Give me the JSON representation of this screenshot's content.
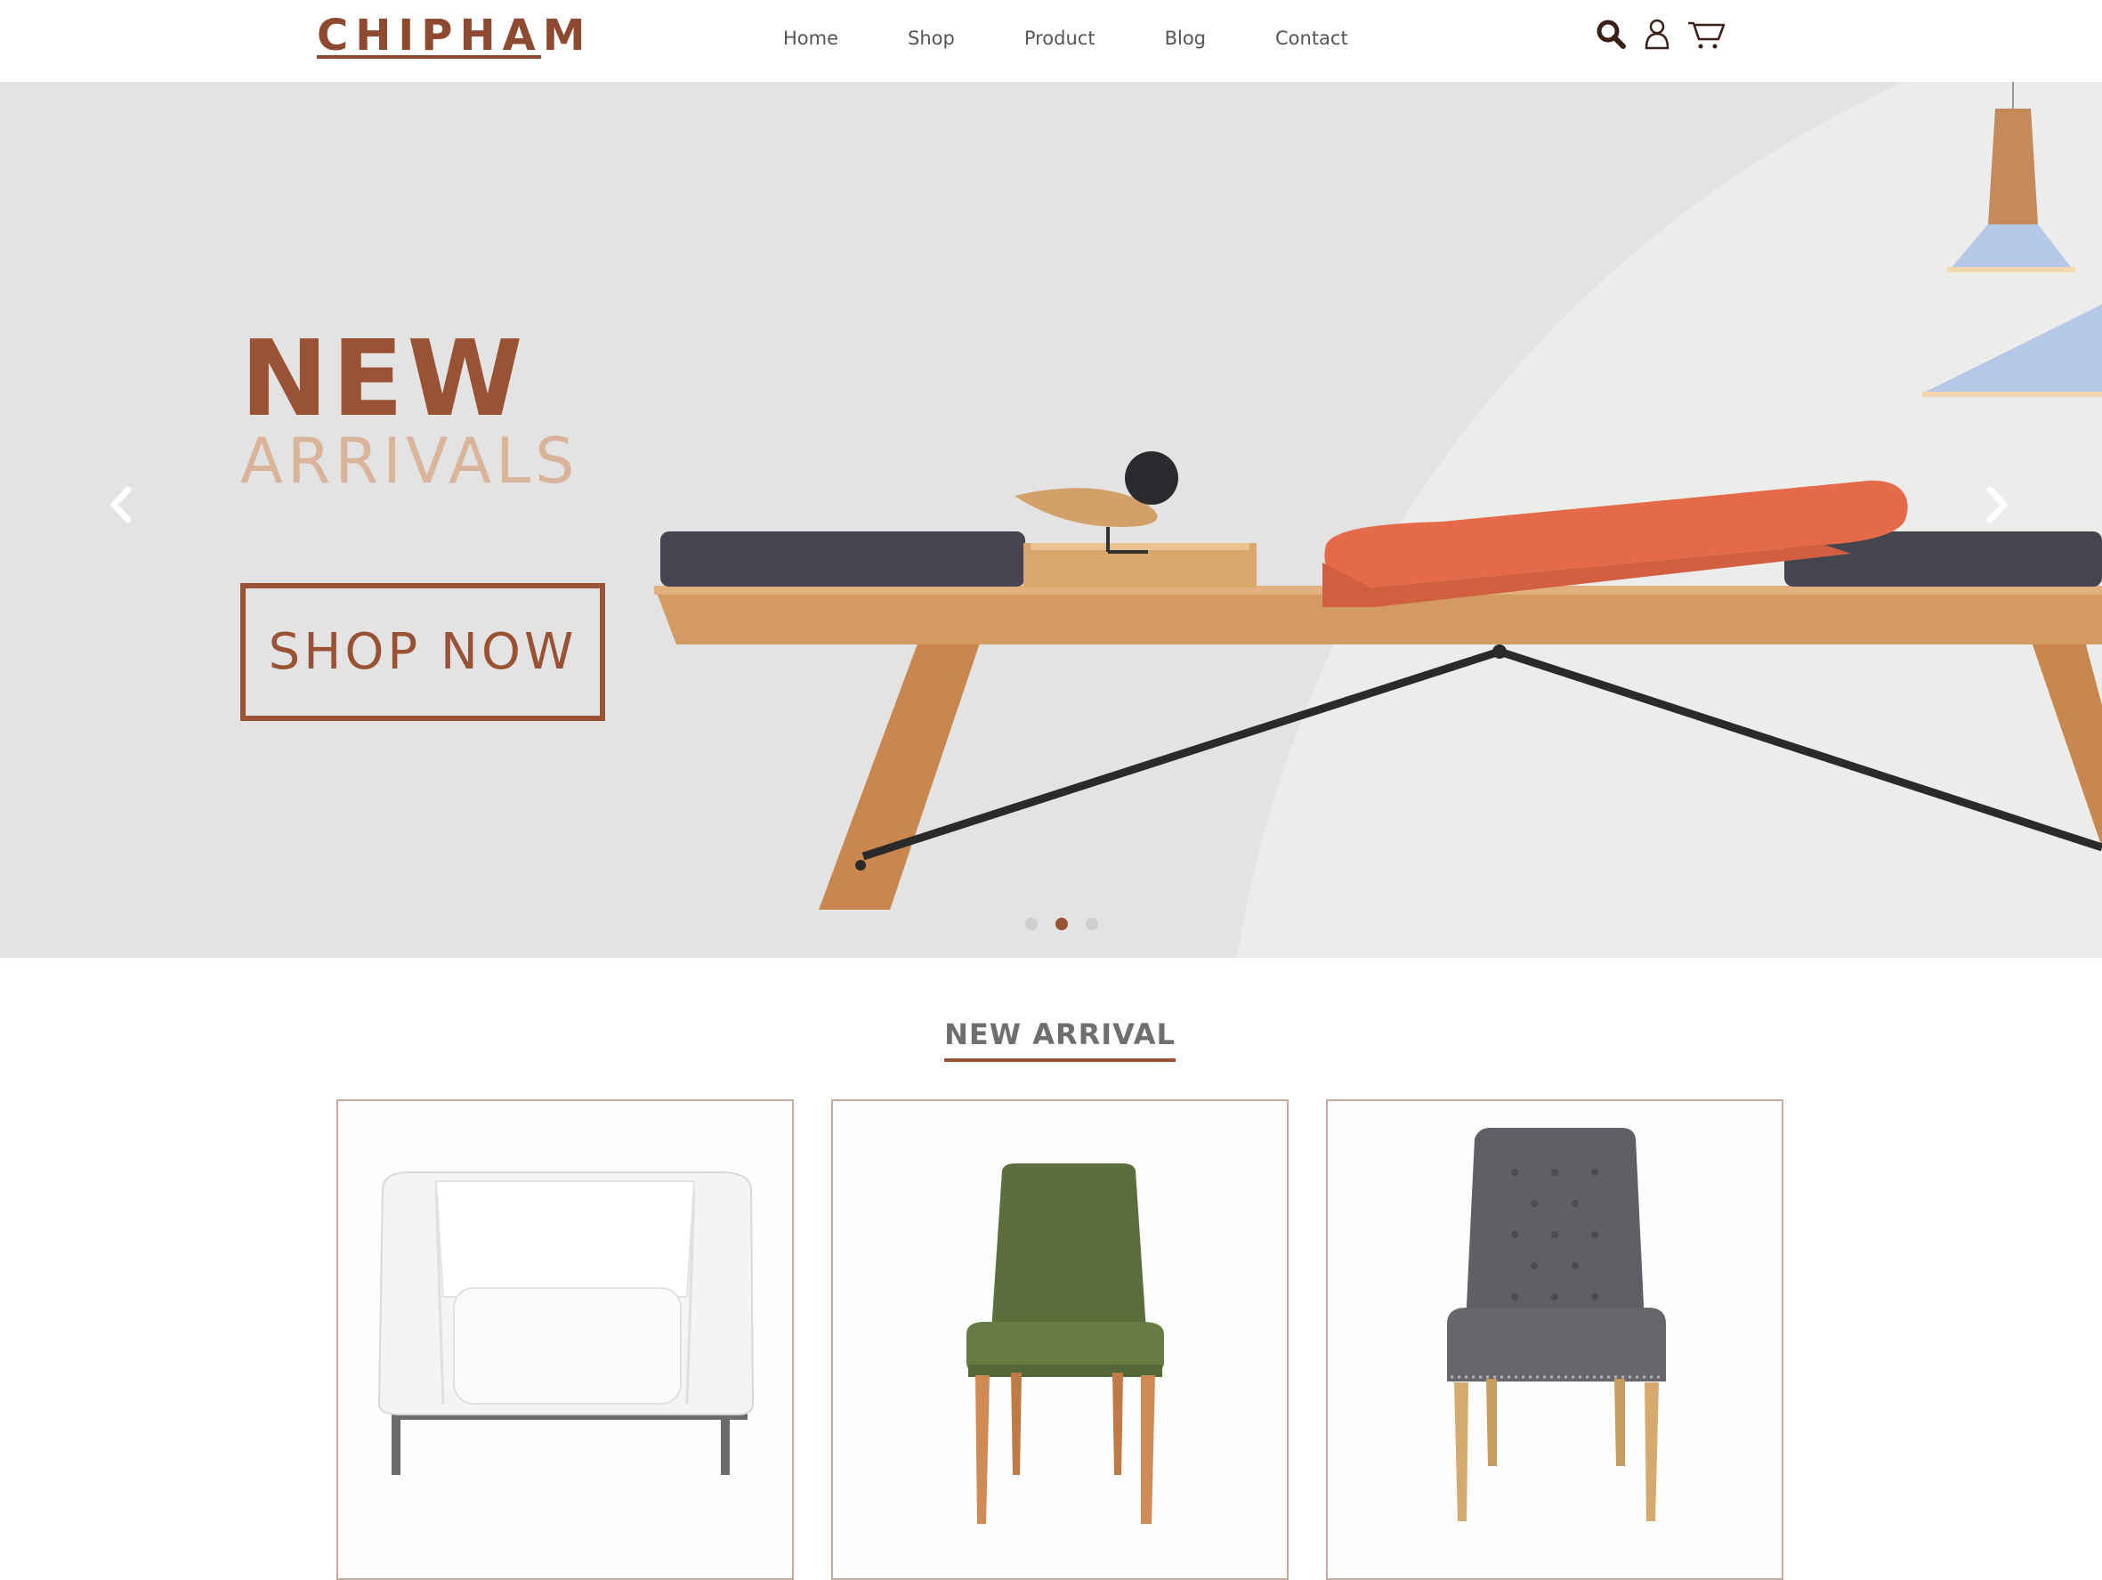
{
  "brand": {
    "logo_text": "CHIPHAM"
  },
  "nav": {
    "items": [
      {
        "label": "Home"
      },
      {
        "label": "Shop"
      },
      {
        "label": "Product"
      },
      {
        "label": "Blog"
      },
      {
        "label": "Contact"
      }
    ]
  },
  "header_icons": [
    "search-icon",
    "user-icon",
    "cart-icon"
  ],
  "hero": {
    "headline": "NEW",
    "subheadline": "ARRIVALS",
    "cta_label": "SHOP NOW",
    "slides_total": 3,
    "active_slide": 2
  },
  "new_arrival": {
    "title": "NEW ARRIVAL",
    "products": [
      {
        "name": "white-armchair"
      },
      {
        "name": "green-dining-chair"
      },
      {
        "name": "grey-tufted-chair"
      }
    ]
  },
  "colors": {
    "brand": "#9a5234",
    "accent_light": "#d9b49a",
    "hero_bg": "#e3e3e3",
    "card_border": "#c8a99a"
  }
}
